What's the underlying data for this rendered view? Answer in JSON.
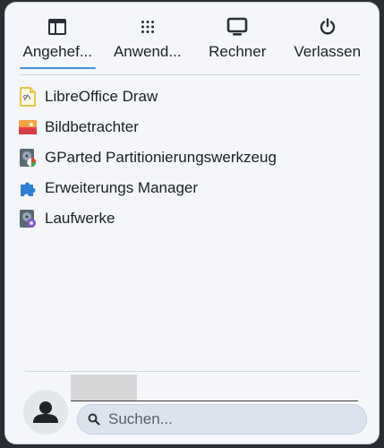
{
  "tabs": [
    {
      "label": "Angehef...",
      "icon": "dashboard-icon",
      "active": true
    },
    {
      "label": "Anwend...",
      "icon": "apps-grid-icon",
      "active": false
    },
    {
      "label": "Rechner",
      "icon": "computer-icon",
      "active": false
    },
    {
      "label": "Verlassen",
      "icon": "power-icon",
      "active": false
    }
  ],
  "apps": [
    {
      "name": "LibreOffice Draw",
      "icon": "libreoffice-draw-icon"
    },
    {
      "name": "Bildbetrachter",
      "icon": "image-viewer-icon"
    },
    {
      "name": "GParted Partitionierungswerkzeug",
      "icon": "gparted-icon"
    },
    {
      "name": "Erweiterungs Manager",
      "icon": "puzzle-piece-icon"
    },
    {
      "name": "Laufwerke",
      "icon": "disks-icon"
    }
  ],
  "search": {
    "placeholder": "Suchen...",
    "value": ""
  },
  "user": {
    "avatar_icon": "user-avatar-icon"
  },
  "colors": {
    "background": "#f4f6fa",
    "accent": "#4a90d9",
    "text": "#1c1f24"
  }
}
